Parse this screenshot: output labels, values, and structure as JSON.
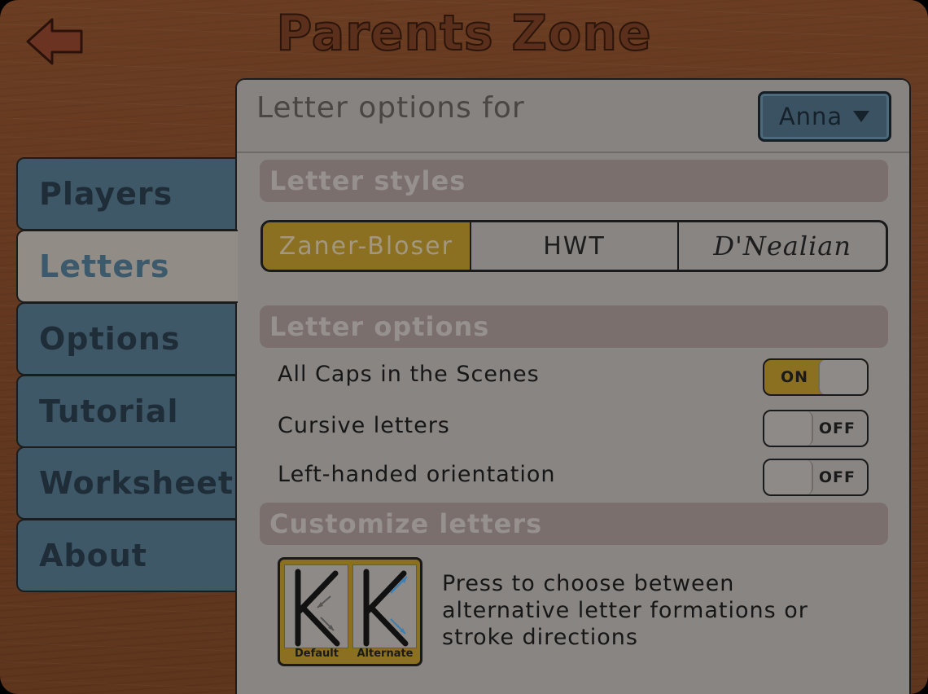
{
  "header": {
    "title": "Parents Zone",
    "back_icon": "back-arrow-icon"
  },
  "tabs": [
    {
      "label": "Players",
      "active": false
    },
    {
      "label": "Letters",
      "active": true
    },
    {
      "label": "Options",
      "active": false
    },
    {
      "label": "Tutorial",
      "active": false
    },
    {
      "label": "Worksheet",
      "active": false
    },
    {
      "label": "About",
      "active": false
    }
  ],
  "panel": {
    "title": "Letter options for",
    "player_select": {
      "value": "Anna",
      "icon": "dropdown-triangle-icon"
    },
    "letter_styles": {
      "heading": "Letter styles",
      "options": [
        "Zaner-Bloser",
        "HWT",
        "D'Nealian"
      ],
      "selected": "Zaner-Bloser"
    },
    "letter_options": {
      "heading": "Letter options",
      "rows": [
        {
          "label": "All Caps in the Scenes",
          "state": "ON"
        },
        {
          "label": "Cursive letters",
          "state": "OFF"
        },
        {
          "label": "Left-handed orientation",
          "state": "OFF"
        }
      ]
    },
    "customize": {
      "heading": "Customize letters",
      "default_caption": "Default",
      "alternate_caption": "Alternate",
      "description": "Press to choose between alternative letter formations or stroke directions"
    }
  },
  "colors": {
    "wood": "#633820",
    "tab_blue": "#3f5868",
    "selected_gold": "#8a7020",
    "panel_gray": "#898583",
    "arrow_blue": "#3c7fb1"
  }
}
